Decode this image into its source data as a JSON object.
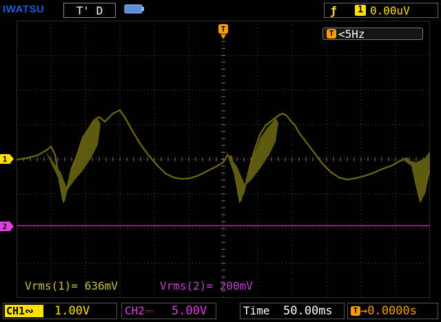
{
  "header": {
    "brand": "IWATSU",
    "mode": "T' D",
    "trigger": {
      "edge_symbol": "ƒ",
      "source": "1",
      "level": "0.00uV"
    },
    "trigger_marker": "T",
    "frequency": {
      "icon": "T",
      "value": "<5Hz"
    }
  },
  "channels": {
    "ch1_marker": "1",
    "ch2_marker": "2"
  },
  "measurements": {
    "ch1": "Vrms(1)= 636mV",
    "ch2": "Vrms(2)= 200mV"
  },
  "footer": {
    "ch1_label": "CH1∾",
    "ch1_scale": "1.00V",
    "ch2_label": "CH2⎓",
    "ch2_scale": "5.00V",
    "time_label": "Time",
    "time_scale": "50.00ms",
    "delay_icon": "T",
    "delay_value": "→0.0000s"
  },
  "colors": {
    "ch1": "#ffe000",
    "ch2": "#e040e0",
    "trigger": "#ff9a00",
    "brand": "#1f5bd6"
  }
}
